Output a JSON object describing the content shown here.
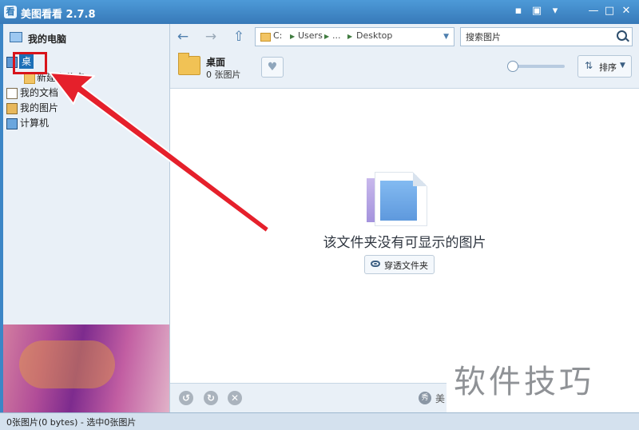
{
  "titlebar": {
    "title": "美图看看 2.7.8",
    "app_icon_text": "看",
    "buttons": [
      "chat-icon",
      "skin-icon",
      "tshirt-icon",
      "minimize-icon",
      "maximize-icon",
      "close-icon"
    ]
  },
  "sidebar": {
    "header": "我的电脑",
    "items": [
      {
        "label": "桌面",
        "selected": true
      },
      {
        "label": "新建文件夹"
      },
      {
        "label": "我的文档"
      },
      {
        "label": "我的图片"
      },
      {
        "label": "计算机"
      }
    ]
  },
  "toolbar": {
    "address": {
      "crumbs": [
        "C:",
        "Users",
        "...",
        "Desktop"
      ]
    },
    "search": {
      "placeholder": "搜索图片"
    }
  },
  "folder": {
    "name": "桌面",
    "count": "0 张图片",
    "sort_label": "排序"
  },
  "empty_state": {
    "message": "该文件夹没有可显示的图片",
    "button_label": "穿透文件夹"
  },
  "bottom": {
    "brand_text": "美",
    "brand_logo": "秀"
  },
  "status": {
    "text": "0张图片(0 bytes) - 选中0张图片"
  },
  "watermark": {
    "text": "软件技巧"
  },
  "colors": {
    "titlebar": "#3c86c6",
    "selection": "#1b6fb7",
    "annotation": "#d8141b"
  }
}
